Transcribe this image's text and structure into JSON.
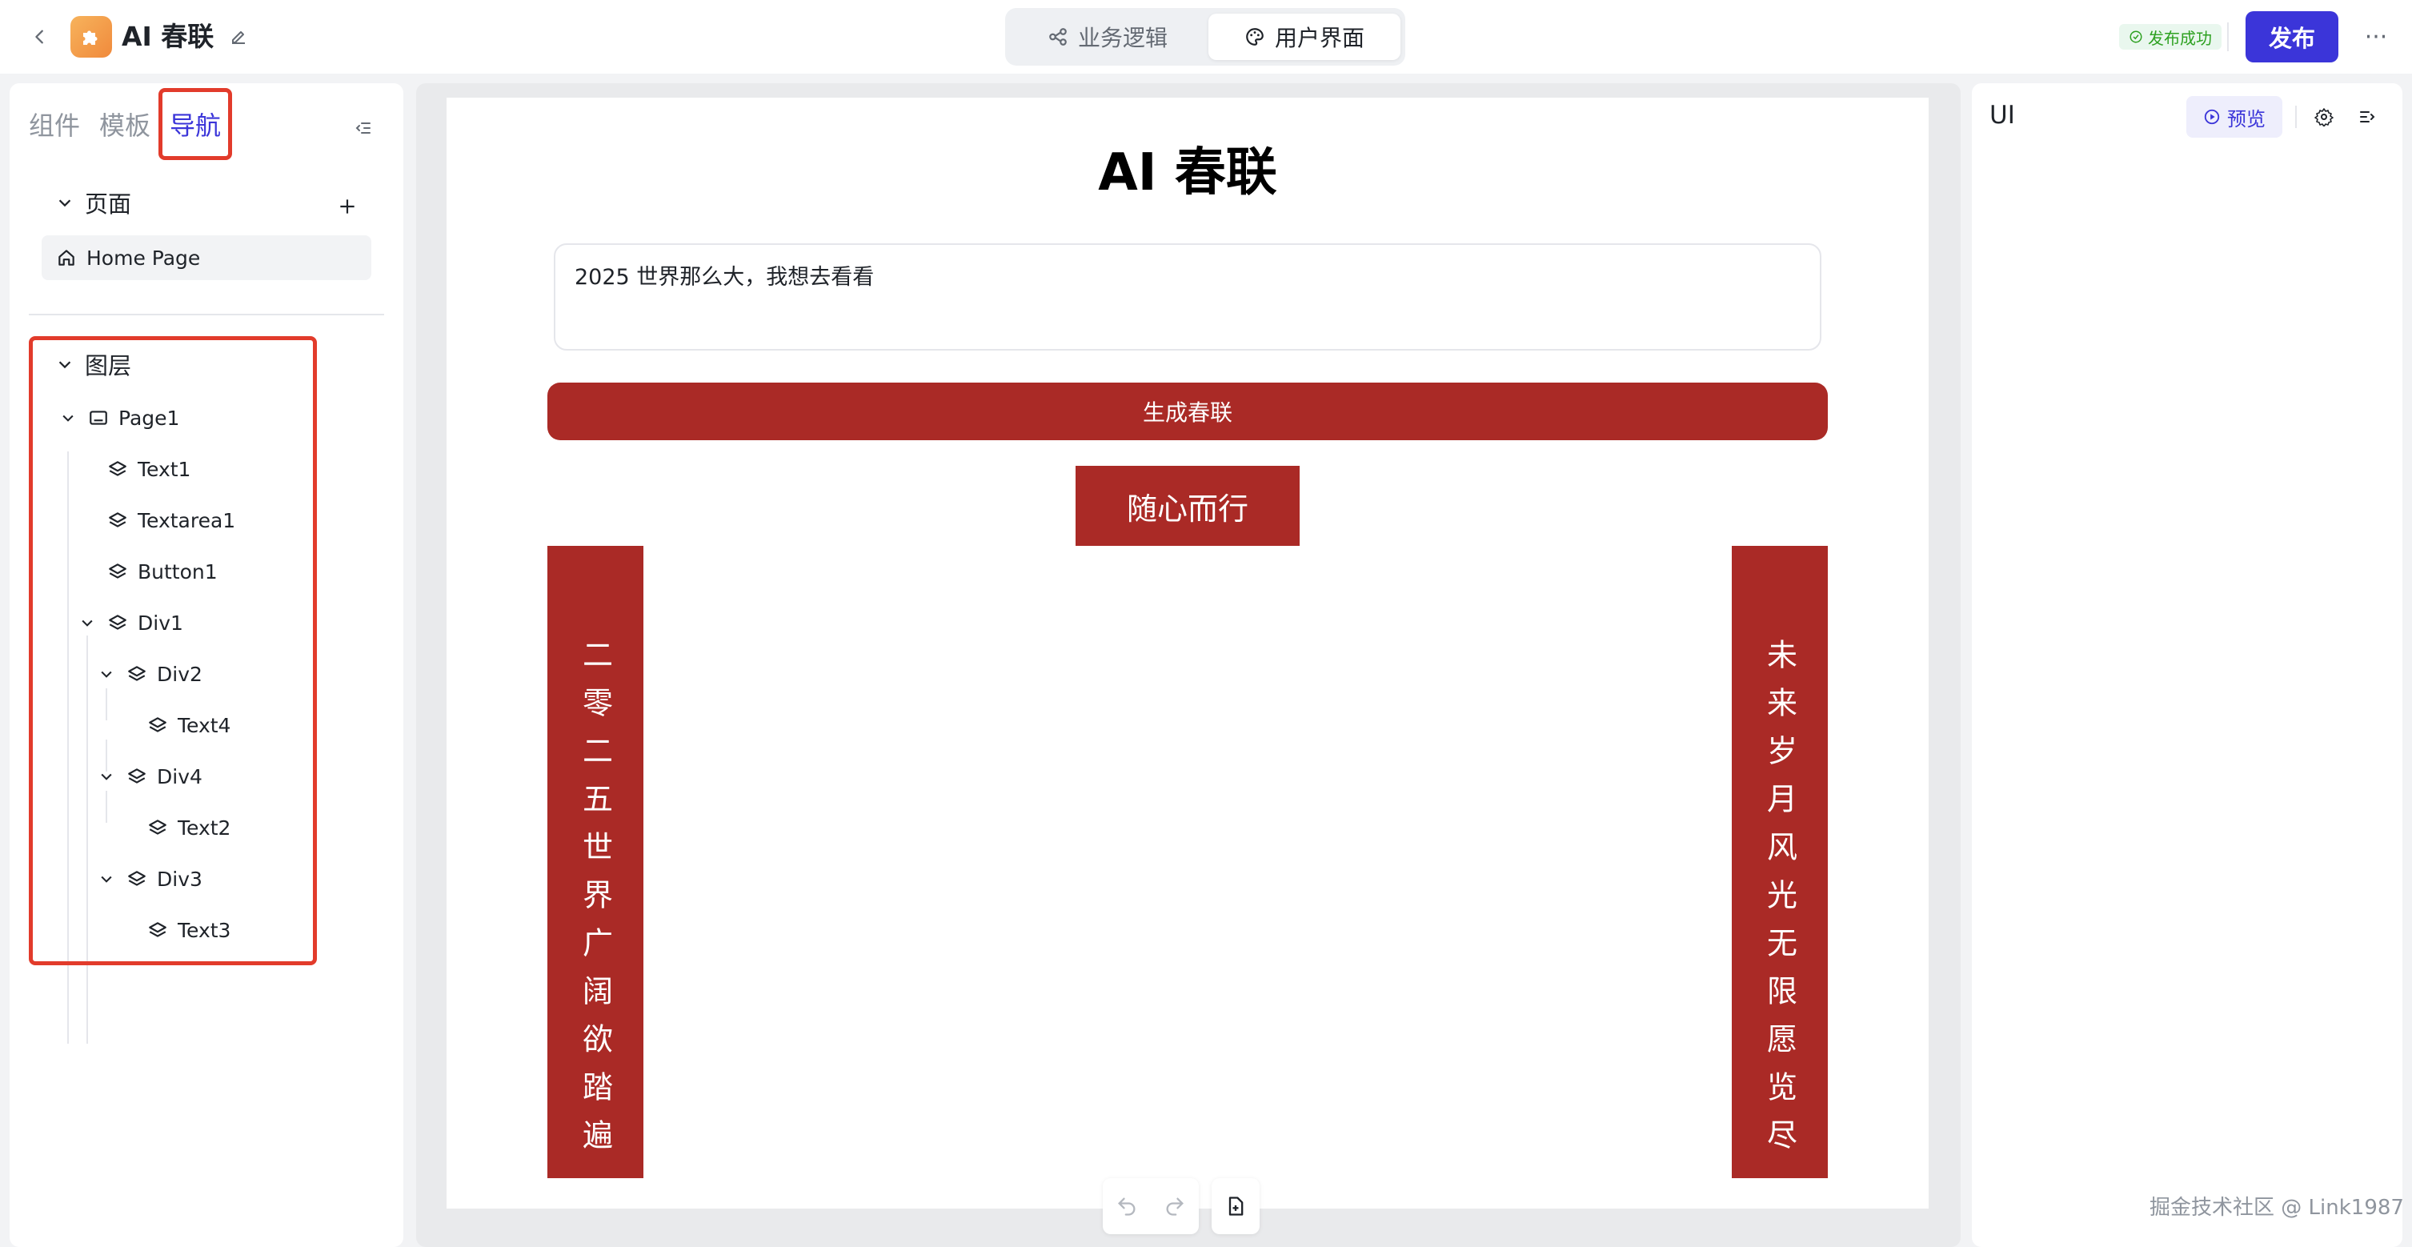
{
  "topbar": {
    "app_title": "AI 春联",
    "tabs": [
      {
        "label": "业务逻辑",
        "icon": "flow-icon"
      },
      {
        "label": "用户界面",
        "icon": "palette-icon"
      }
    ],
    "status": "发布成功",
    "publish_label": "发布",
    "more_label": "···"
  },
  "left_panel": {
    "tabs": [
      "组件",
      "模板",
      "导航"
    ],
    "active_tab": "导航",
    "pages_label": "页面",
    "pages": [
      {
        "label": "Home Page",
        "icon": "home-icon"
      }
    ],
    "layers_label": "图层",
    "layers": [
      {
        "label": "Page1",
        "depth": 0,
        "expanded": true,
        "icon": "page-icon"
      },
      {
        "label": "Text1",
        "depth": 1,
        "icon": "layers-icon"
      },
      {
        "label": "Textarea1",
        "depth": 1,
        "icon": "layers-icon"
      },
      {
        "label": "Button1",
        "depth": 1,
        "icon": "layers-icon"
      },
      {
        "label": "Div1",
        "depth": 1,
        "expanded": true,
        "icon": "layers-icon"
      },
      {
        "label": "Div2",
        "depth": 2,
        "expanded": true,
        "icon": "layers-icon"
      },
      {
        "label": "Text4",
        "depth": 3,
        "icon": "layers-icon"
      },
      {
        "label": "Div4",
        "depth": 2,
        "expanded": true,
        "icon": "layers-icon"
      },
      {
        "label": "Text2",
        "depth": 3,
        "icon": "layers-icon"
      },
      {
        "label": "Div3",
        "depth": 2,
        "expanded": true,
        "icon": "layers-icon"
      },
      {
        "label": "Text3",
        "depth": 3,
        "icon": "layers-icon"
      }
    ]
  },
  "canvas": {
    "heading": "AI 春联",
    "prompt_value": "2025 世界那么大，我想去看看",
    "generate_label": "生成春联",
    "horizontal_scroll": "随心而行",
    "left_couplet": "二零二五世界广阔欲踏遍",
    "right_couplet": "未来岁月风光无限愿览尽"
  },
  "right_panel": {
    "title": "UI",
    "preview_label": "预览"
  },
  "watermark": "掘金技术社区 @ Link1987",
  "colors": {
    "accent": "#3b35d9",
    "couplet_red": "#aa2a26",
    "highlight": "#e23b2b",
    "success": "#2ea121"
  }
}
